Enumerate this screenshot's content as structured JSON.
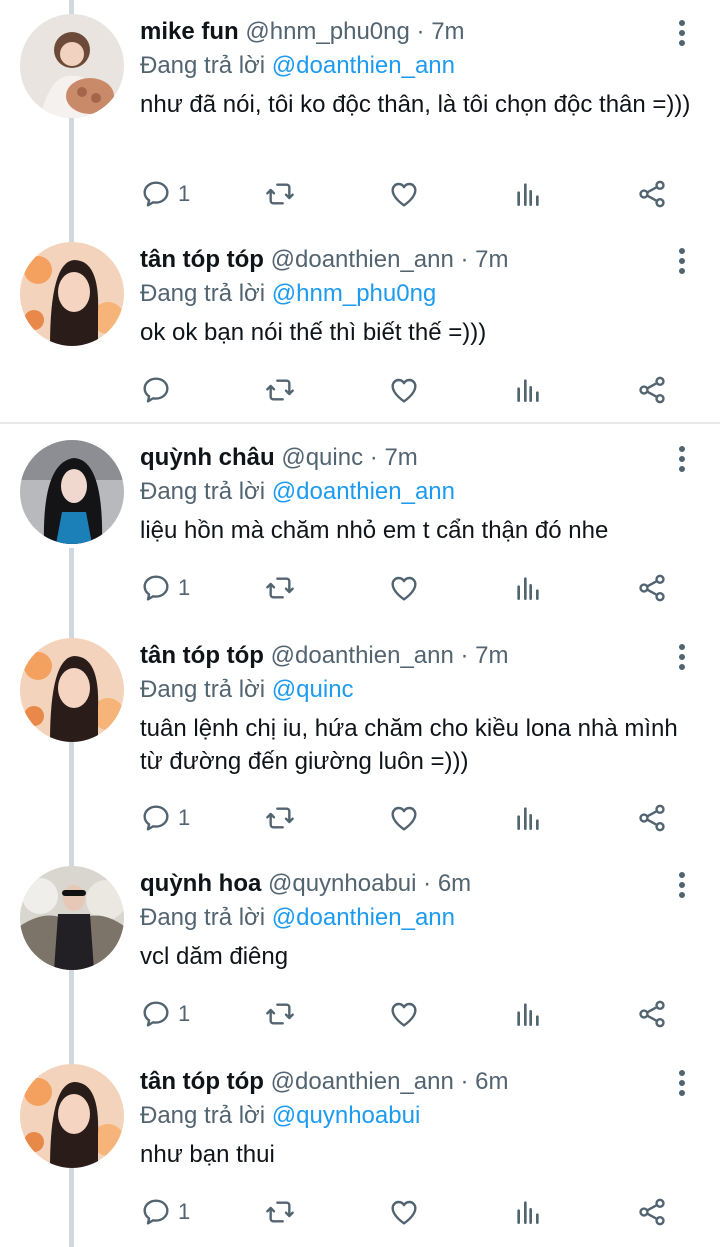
{
  "reply_prefix": "Đang trả lời",
  "colors": {
    "accent": "#1d9bf0",
    "muted": "#536471",
    "text": "#0f1419",
    "thread_line": "#cfd9de"
  },
  "tweets": [
    {
      "name": "mike fun",
      "handle": "@hnm_phu0ng",
      "sep": "·",
      "time": "7m",
      "reply_to": "@doanthien_ann",
      "text": "như đã nói, tôi ko độc thân, là tôi chọn độc thân =)))",
      "reply_count": "1",
      "avatar": "avatar-mike"
    },
    {
      "name": "tân tóp tóp",
      "handle": "@doanthien_ann",
      "sep": "·",
      "time": "7m",
      "reply_to": "@hnm_phu0ng",
      "text": "ok ok bạn nói thế thì biết thế =)))",
      "reply_count": "",
      "avatar": "avatar-tan"
    },
    {
      "name": "quỳnh châu",
      "handle": "@quinc",
      "sep": "·",
      "time": "7m",
      "reply_to": "@doanthien_ann",
      "text": "liệu hồn mà chăm nhỏ em t cẩn thận đó nhe",
      "reply_count": "1",
      "avatar": "avatar-quinc"
    },
    {
      "name": "tân tóp tóp",
      "handle": "@doanthien_ann",
      "sep": "·",
      "time": "7m",
      "reply_to": "@quinc",
      "text": "tuân lệnh chị iu, hứa chăm cho kiều lona nhà mình từ đường đến giường luôn =)))",
      "reply_count": "1",
      "avatar": "avatar-tan"
    },
    {
      "name": "quỳnh hoa",
      "handle": "@quynhoabui",
      "sep": "·",
      "time": "6m",
      "reply_to": "@doanthien_ann",
      "text": "vcl dăm điêng",
      "reply_count": "1",
      "avatar": "avatar-hoa"
    },
    {
      "name": "tân tóp tóp",
      "handle": "@doanthien_ann",
      "sep": "·",
      "time": "6m",
      "reply_to": "@quynhoabui",
      "text": "như bạn thui",
      "reply_count": "1",
      "avatar": "avatar-tan"
    }
  ]
}
